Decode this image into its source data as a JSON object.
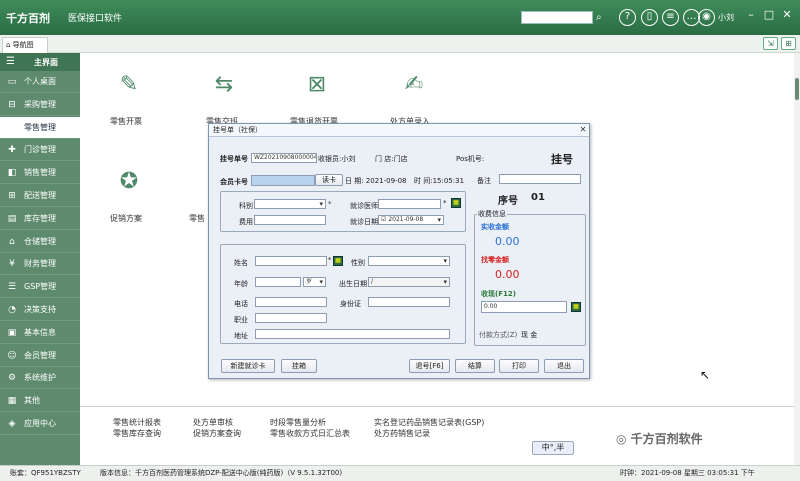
{
  "app": {
    "logo": "千方百剂",
    "name": "医保接口软件",
    "username": "小刘"
  },
  "tabs": {
    "nav": "导航图"
  },
  "sidebar": {
    "header": "主界面",
    "items": [
      {
        "label": "个人桌面",
        "icon": "desktop-icon"
      },
      {
        "label": "采购管理",
        "icon": "cart-icon"
      },
      {
        "label": "零售管理",
        "icon": "retail-icon"
      },
      {
        "label": "门诊管理",
        "icon": "clinic-icon"
      },
      {
        "label": "销售管理",
        "icon": "sales-icon"
      },
      {
        "label": "配送管理",
        "icon": "delivery-icon"
      },
      {
        "label": "库存管理",
        "icon": "inventory-icon"
      },
      {
        "label": "仓储管理",
        "icon": "warehouse-icon"
      },
      {
        "label": "财务管理",
        "icon": "finance-icon"
      },
      {
        "label": "GSP管理",
        "icon": "gsp-icon"
      },
      {
        "label": "决策支持",
        "icon": "decision-icon"
      },
      {
        "label": "基本信息",
        "icon": "info-icon"
      },
      {
        "label": "会员管理",
        "icon": "member-icon"
      },
      {
        "label": "系统维护",
        "icon": "system-icon"
      },
      {
        "label": "其他",
        "icon": "other-icon"
      },
      {
        "label": "应用中心",
        "icon": "app-center-icon"
      }
    ]
  },
  "features": {
    "retail_open": "零售开票",
    "retail_exchange": "零售交班",
    "retail_return": "零售退货开票",
    "prescription_entry": "处方单录入",
    "promotion": "促销方案",
    "partial": "零售"
  },
  "reports": {
    "col1": [
      "零售统计报表",
      "零售库存查询"
    ],
    "col2": [
      "处方单审核",
      "促销方案查询"
    ],
    "col3": [
      "时段零售量分析",
      "零售收款方式日汇总表"
    ],
    "col4": [
      "实名登记药品销售记录表(GSP)",
      "处方药销售记录"
    ]
  },
  "dialog": {
    "title": "挂号单（社保）",
    "reg_no_label": "挂号单号",
    "reg_no": "WZ20210908000004",
    "cashier": "收银员:小刘",
    "store": "门  店:门店",
    "pos_label": "Pos机号:",
    "big_title": "挂号",
    "member_card_label": "会员卡号",
    "read_card": "读卡",
    "date": "日  期: 2021-09-08",
    "time": "时  间:15:05:31",
    "remark_label": "备注",
    "seq_label": "序号",
    "seq_value": "01",
    "dept_label": "科别",
    "doctor_label": "就诊医师",
    "fee_label": "费用",
    "visit_date_label": "就诊日期",
    "visit_date": "2021-09-08",
    "name_label": "姓名",
    "gender_label": "性别",
    "age_label": "年龄",
    "age_unit": "岁",
    "birth_label": "出生日期",
    "birth_value": "/",
    "phone_label": "电话",
    "id_label": "身份证",
    "job_label": "职业",
    "address_label": "地址",
    "pay_info_title": "收费信息",
    "received_label": "实收金额",
    "received_value": "0.00",
    "change_label": "找零金额",
    "change_value": "0.00",
    "cash_label": "收现(F12)",
    "cash_value": "0.00",
    "pay_method_label": "付款方式(Z)",
    "pay_method_value": "现    金",
    "buttons": {
      "new_visit": "新建就诊卡",
      "print_form": "挂箱",
      "refund": "退号[F6]",
      "settle": "结算",
      "print": "打印",
      "exit": "退出"
    }
  },
  "status": {
    "account": "账套：QF951YBZSTY",
    "version": "版本信息：千方百剂医药管理系统DZP-配送中心版(纯药版)（V 9.5.1.32T00)",
    "clock": "时钟：2021-09-08 星期三 03:05:31 下午"
  },
  "ime": "中°,半",
  "watermark": "千方百剂软件",
  "colors": {
    "titlebar": "#2f7a4c",
    "sidebar": "#5e8b6e",
    "accent_blue": "#2c6fd6",
    "accent_red": "#d62222"
  }
}
